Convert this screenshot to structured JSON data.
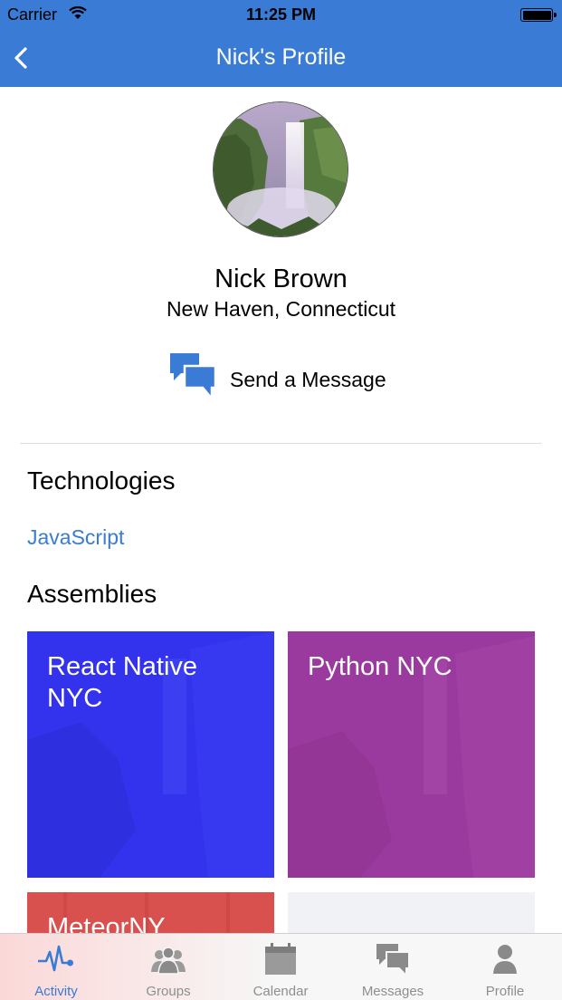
{
  "status_bar": {
    "carrier": "Carrier",
    "time": "11:25 PM"
  },
  "nav": {
    "title": "Nick's Profile"
  },
  "profile": {
    "name": "Nick Brown",
    "location": "New Haven, Connecticut",
    "send_message_label": "Send a Message"
  },
  "sections": {
    "technologies_title": "Technologies",
    "technologies": [
      "JavaScript"
    ],
    "assemblies_title": "Assemblies"
  },
  "assemblies": [
    {
      "name": "React Native NYC",
      "color": "#3333ee"
    },
    {
      "name": "Python NYC",
      "color": "#9b3a9e"
    },
    {
      "name": "MeteorNY",
      "color": "#d9514e"
    },
    {
      "name": "",
      "color": "#f1f2f6"
    }
  ],
  "tabs": [
    {
      "label": "Activity",
      "icon": "activity-icon",
      "active": true
    },
    {
      "label": "Groups",
      "icon": "groups-icon",
      "active": false
    },
    {
      "label": "Calendar",
      "icon": "calendar-icon",
      "active": false
    },
    {
      "label": "Messages",
      "icon": "messages-icon",
      "active": false
    },
    {
      "label": "Profile",
      "icon": "profile-icon",
      "active": false
    }
  ],
  "colors": {
    "brand": "#3a7bd5",
    "tab_inactive": "#8e8e8e"
  }
}
